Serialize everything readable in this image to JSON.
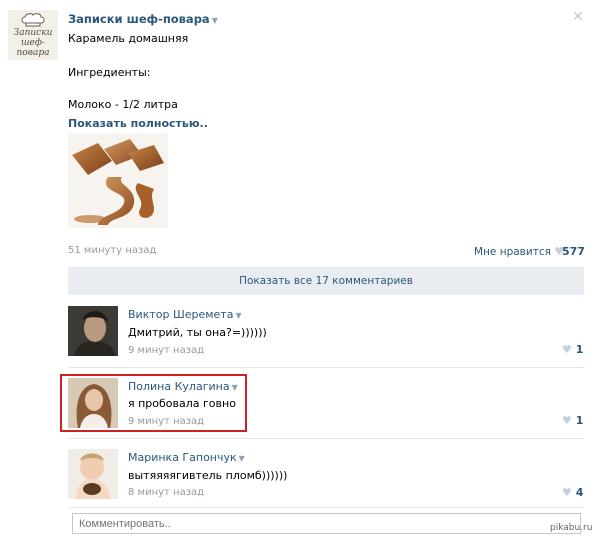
{
  "post": {
    "author": "Записки шеф-повара",
    "avatar_text": "Записки шеф-повара",
    "lines": [
      "Карамель домашняя",
      "Ингредиенты:",
      "Молоко - 1/2 литра"
    ],
    "show_more": "Показать полностью..",
    "time": "51 минуту назад",
    "like_label": "Мне нравится",
    "like_count": "577",
    "show_all_comments": "Показать все 17 комментариев"
  },
  "comments": [
    {
      "author": "Виктор Шеремета",
      "text": "Дмитрий, ты она?=))))))",
      "time": "9 минут назад",
      "likes": "1"
    },
    {
      "author": "Полина Кулагина",
      "text": "я пробовала говно",
      "time": "9 минут назад",
      "likes": "1"
    },
    {
      "author": "Маринка Гапончук",
      "text": "вытяяяягивтель пломб))))))",
      "time": "8 минут назад",
      "likes": "4"
    }
  ],
  "comment_input": {
    "placeholder": "Комментировать.."
  },
  "watermark": "pikabu.ru",
  "colors": {
    "link": "#2b587a",
    "muted": "#999999",
    "highlight": "#d02020",
    "bar": "#e9edf1"
  },
  "icons": [
    "chef-hat-icon",
    "close-icon",
    "heart-icon",
    "dropdown-arrow-icon"
  ]
}
